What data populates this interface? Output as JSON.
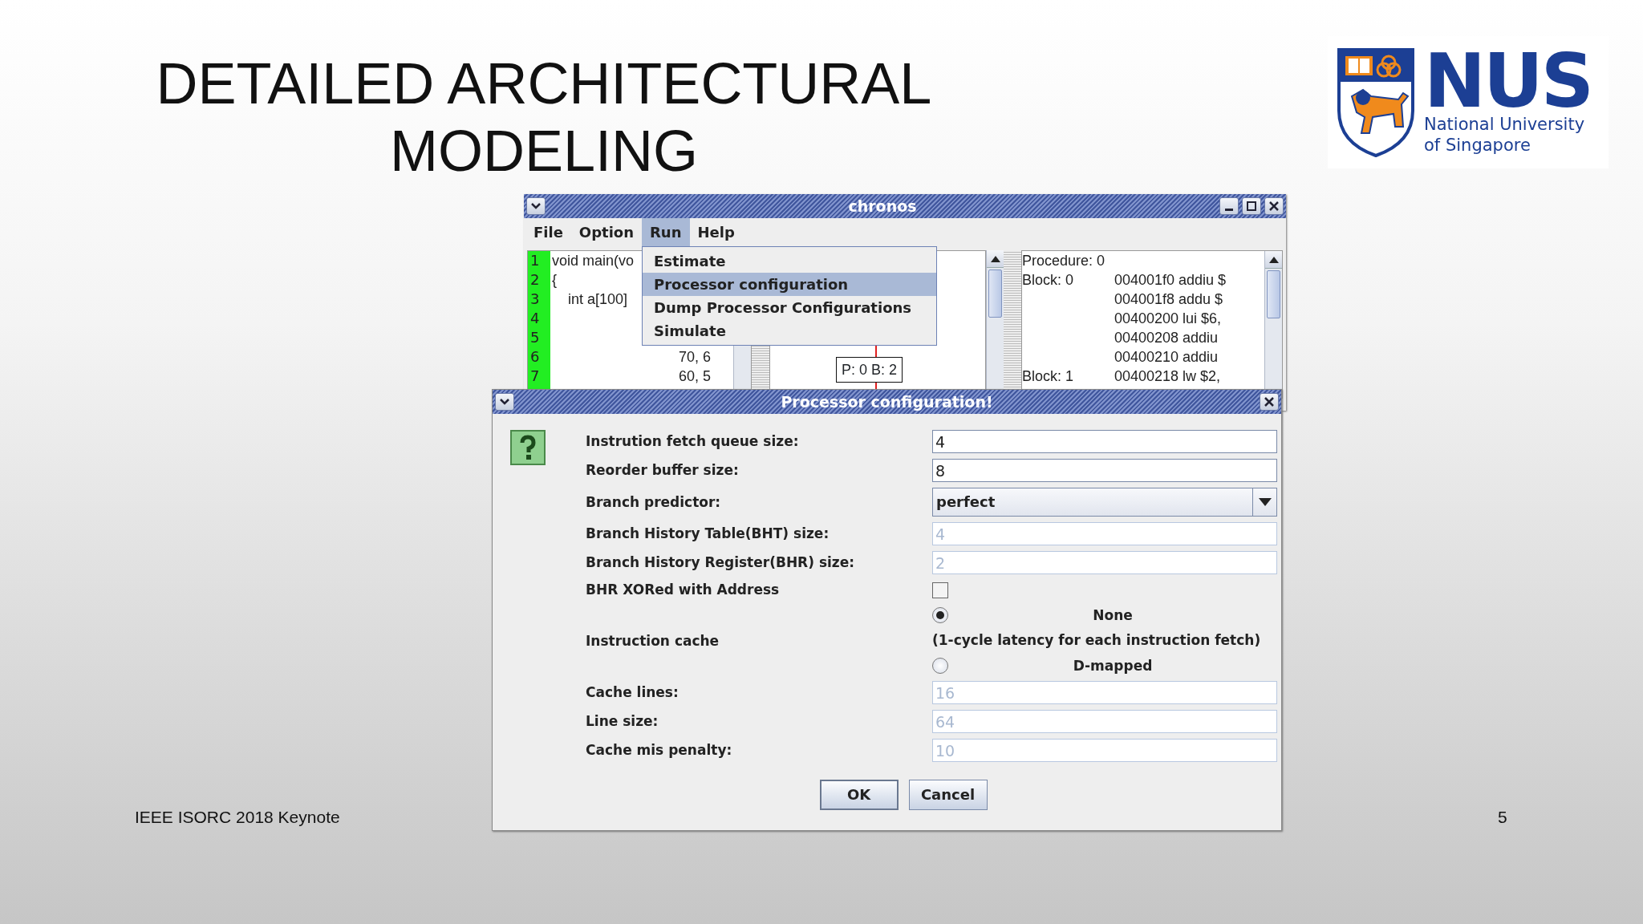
{
  "slide": {
    "title": "DETAILED ARCHITECTURAL MODELING",
    "footer": "IEEE ISORC 2018 Keynote",
    "page_number": "5"
  },
  "logo": {
    "wordmark": "NUS",
    "name_line_1": "National University",
    "name_line_2": "of Singapore"
  },
  "main_window": {
    "title": "chronos",
    "menus": [
      {
        "label": "File",
        "selected": false
      },
      {
        "label": "Option",
        "selected": false
      },
      {
        "label": "Run",
        "selected": true
      },
      {
        "label": "Help",
        "selected": false
      }
    ],
    "run_menu": [
      {
        "label": "Estimate",
        "selected": false
      },
      {
        "label": "Processor configuration",
        "selected": true
      },
      {
        "label": "Dump Processor Configurations",
        "selected": false
      },
      {
        "label": "Simulate",
        "selected": false
      }
    ],
    "code_lines": [
      {
        "number": "1",
        "text": "void main(vo",
        "kind": "plain"
      },
      {
        "number": "2",
        "text": "{",
        "kind": "plain"
      },
      {
        "number": "3",
        "text": "int a[100]",
        "kind": "indented"
      },
      {
        "number": "4"
      },
      {
        "number": "5"
      },
      {
        "number": "6",
        "text": "70, 6",
        "kind": "continuation"
      },
      {
        "number": "7",
        "text": "60, 5",
        "kind": "continuation"
      }
    ],
    "graph_node": "P: 0 B: 2",
    "assembly": [
      {
        "label": "Procedure: 0"
      },
      {
        "label": "Block: 0",
        "instruction": "004001f0 addiu $"
      },
      {
        "instruction": "004001f8 addu $"
      },
      {
        "instruction": "00400200 lui $6,"
      },
      {
        "instruction": "00400208 addiu"
      },
      {
        "instruction": "00400210 addiu"
      },
      {
        "label": "Block: 1",
        "instruction": "00400218 lw $2,"
      }
    ]
  },
  "dialog": {
    "title": "Processor configuration!",
    "rows": [
      {
        "kind": "text",
        "label": "Instrution fetch queue size:",
        "value": "4",
        "disabled": false
      },
      {
        "kind": "text",
        "label": "Reorder buffer size:",
        "value": "8",
        "disabled": false
      },
      {
        "kind": "select",
        "label": "Branch predictor:",
        "value": "perfect"
      },
      {
        "kind": "text",
        "label": "Branch History Table(BHT) size:",
        "value": "4",
        "disabled": true
      },
      {
        "kind": "text",
        "label": "Branch History Register(BHR) size:",
        "value": "2",
        "disabled": true
      },
      {
        "kind": "checkbox",
        "label": "BHR XORed with Address",
        "checked": false
      },
      {
        "kind": "radio",
        "label": "Instruction cache",
        "options": [
          {
            "label": "None",
            "note": "(1-cycle latency for each instruction fetch)",
            "selected": true
          },
          {
            "label": "D-mapped",
            "selected": false
          }
        ]
      },
      {
        "kind": "text",
        "label": "Cache lines:",
        "value": "16",
        "disabled": true
      },
      {
        "kind": "text",
        "label": "Line size:",
        "value": "64",
        "disabled": true
      },
      {
        "kind": "text",
        "label": "Cache mis penalty:",
        "value": "10",
        "disabled": true
      }
    ],
    "buttons": [
      "OK",
      "Cancel"
    ]
  }
}
